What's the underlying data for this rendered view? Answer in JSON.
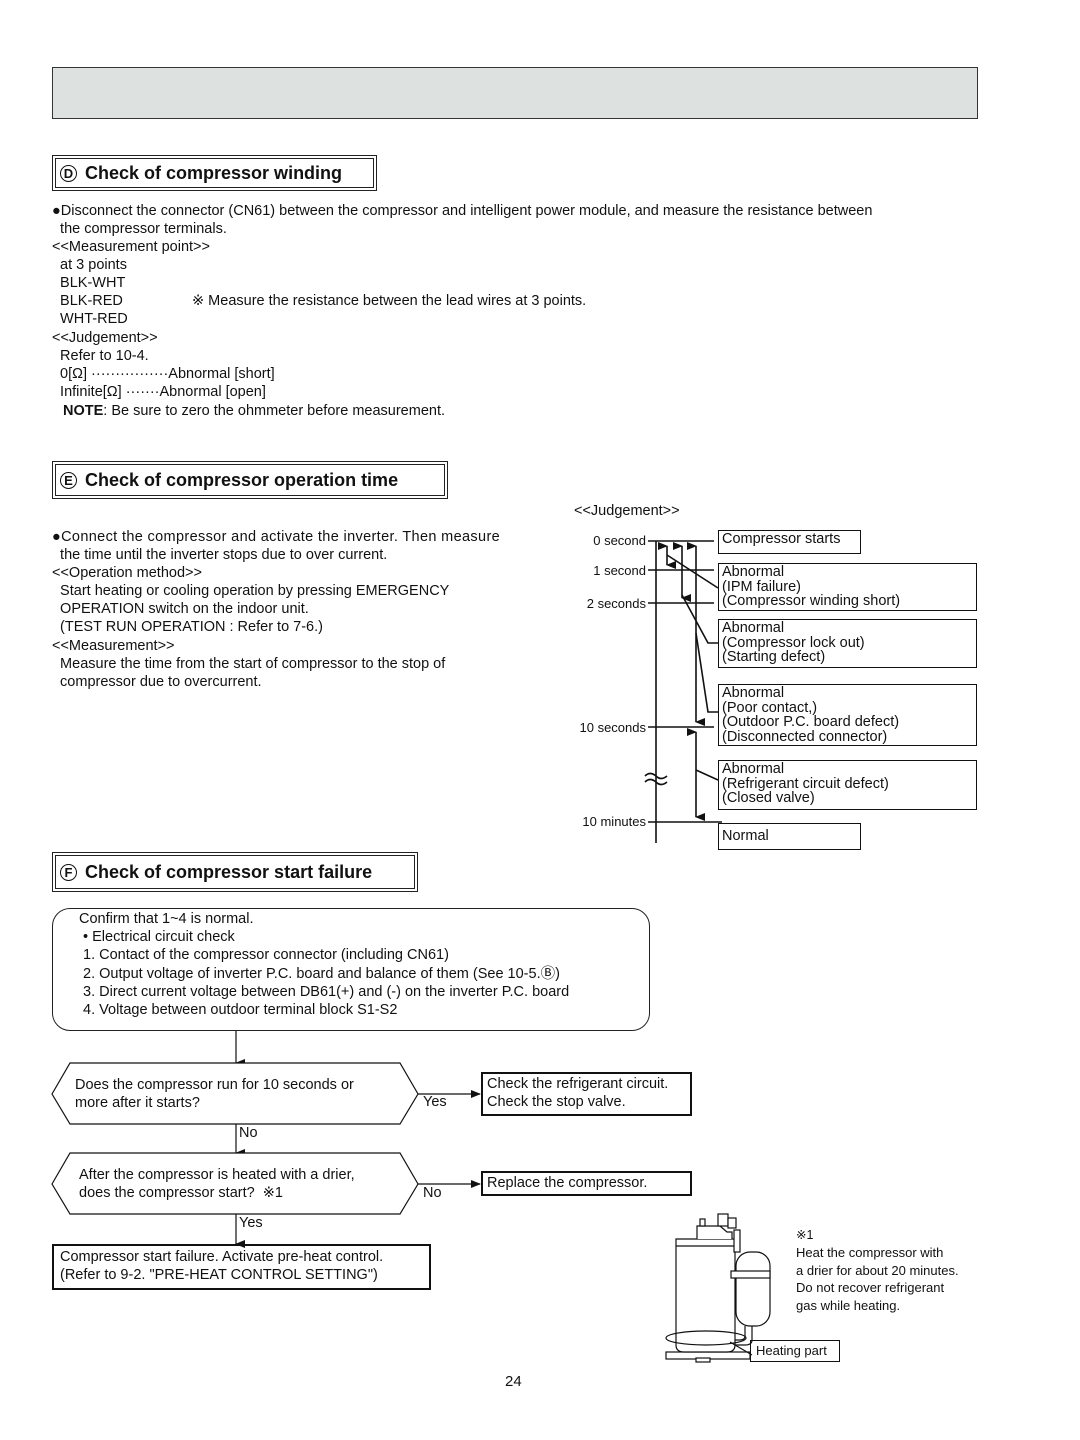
{
  "page_number": "24",
  "section_d": {
    "letter": "D",
    "title": "Check of compressor winding",
    "intro_line1": "●Disconnect the connector (CN61) between the compressor and intelligent power module, and measure the resistance between",
    "intro_line2": "  the compressor terminals.",
    "measurement_heading": "<<Measurement point>>",
    "points_label": "  at 3 points",
    "points": [
      "  BLK-WHT",
      "  BLK-RED",
      "  WHT-RED"
    ],
    "points_note": "※ Measure the resistance between the lead wires at 3 points.",
    "judgement_heading": "<<Judgement>>",
    "refer": "  Refer to 10-4.",
    "judgements": [
      "  0[Ω] ················Abnormal [short]",
      "  Infinite[Ω] ·······Abnormal [open]"
    ],
    "note_label": "NOTE",
    "note_text": ": Be sure to zero the ohmmeter before measurement."
  },
  "section_e": {
    "letter": "E",
    "title": "Check of compressor operation time",
    "lines": [
      "●Connect the compressor and activate the inverter. Then measure",
      "  the time until the inverter stops due to over current.",
      "<<Operation method>>",
      "  Start heating or cooling operation by pressing EMERGENCY",
      "  OPERATION switch on the indoor unit.",
      "  (TEST RUN OPERATION : Refer to 7-6.)",
      "<<Measurement>>",
      "  Measure the time from the start of compressor to the stop of",
      "  compressor due to overcurrent."
    ],
    "judgement_heading": "<<Judgement>>",
    "time_labels": [
      "0 second",
      "1 second",
      "2 seconds",
      "10 seconds",
      "10 minutes"
    ],
    "results": [
      {
        "lines": "Compressor starts"
      },
      {
        "lines": "Abnormal\n(IPM failure)\n(Compressor winding short)"
      },
      {
        "lines": "Abnormal\n(Compressor lock out)\n(Starting defect)"
      },
      {
        "lines": "Abnormal\n(Poor contact,)\n(Outdoor P.C. board defect)\n(Disconnected connector)"
      },
      {
        "lines": "Abnormal\n(Refrigerant circuit defect)\n(Closed valve)"
      },
      {
        "lines": "Normal"
      }
    ]
  },
  "section_f": {
    "letter": "F",
    "title": "Check of compressor start failure",
    "confirm": "Confirm that 1~4 is normal.",
    "confirm_items": [
      " • Electrical circuit check",
      " 1. Contact of the compressor connector (including CN61)",
      " 2. Output voltage of inverter P.C. board and balance of them (See 10-5.Ⓑ)",
      " 3. Direct current voltage between DB61(+) and (-) on the inverter P.C. board",
      " 4. Voltage between outdoor terminal block S1-S2"
    ],
    "decision1": "Does the compressor run for 10 seconds or\nmore after it starts?",
    "decision1_yes": "Yes",
    "decision1_no": "No",
    "decision1_yes_action": "Check the refrigerant circuit.\nCheck the stop valve.",
    "decision2": "After the compressor is heated with a drier,\ndoes the compressor start?  ※1",
    "decision2_no": "No",
    "decision2_yes": "Yes",
    "decision2_no_action": "Replace the compressor.",
    "final_action": "Compressor start failure. Activate pre-heat control.\n(Refer to 9-2. \"PRE-HEAT CONTROL SETTING\")",
    "footnote_mark": "※1",
    "footnote_lines": "Heat the compressor with\na drier for about 20 minutes.\nDo not recover refrigerant\ngas while heating.",
    "heating_part_label": "Heating part"
  }
}
